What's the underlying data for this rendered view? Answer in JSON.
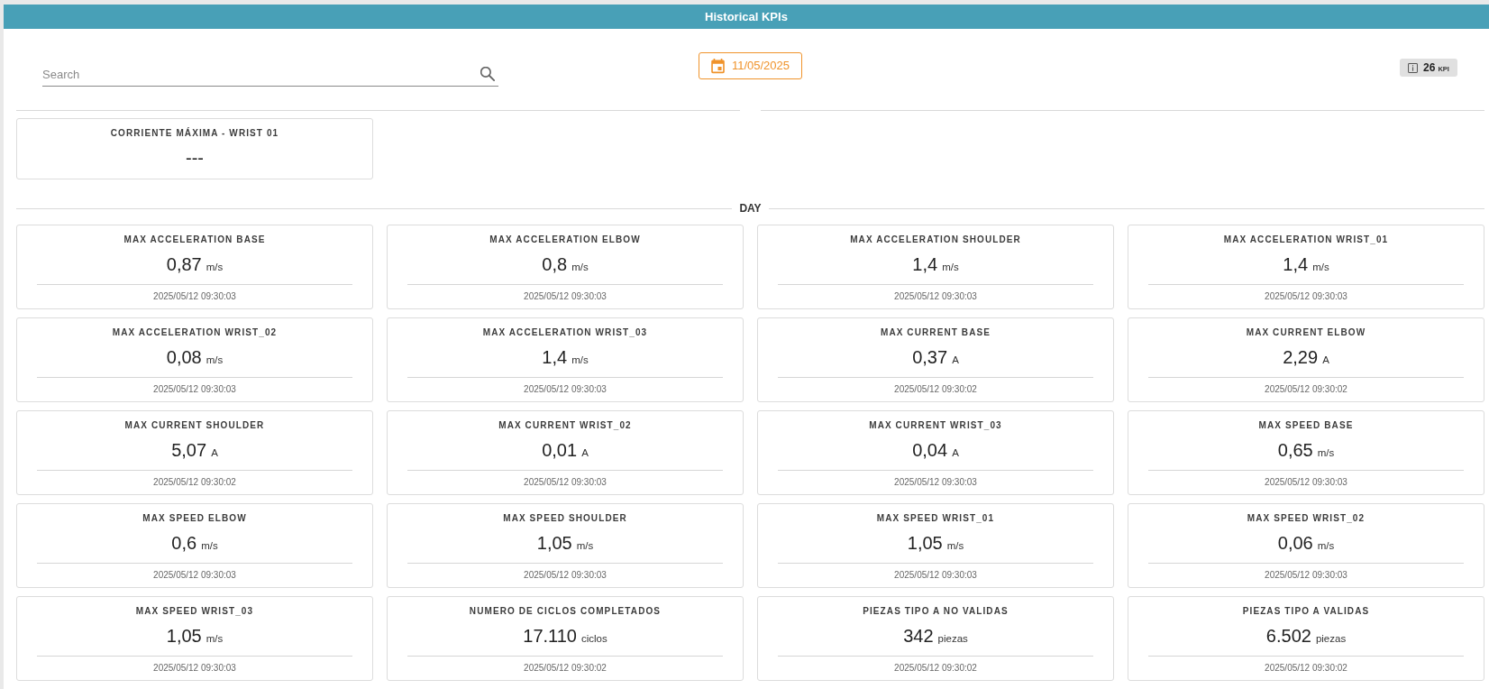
{
  "header": {
    "title": "Historical KPIs"
  },
  "toolbar": {
    "search": {
      "placeholder": "Search"
    },
    "date_button": {
      "label": "11/05/2025"
    },
    "kpi_badge": {
      "count": "26",
      "unit": "KPI"
    }
  },
  "pinned_cards": [
    {
      "title": "CORRIENTE MÁXIMA - WRIST 01",
      "value": "---"
    }
  ],
  "sections": [
    {
      "title": "DAY",
      "cards": [
        {
          "title": "MAX ACCELERATION BASE",
          "value": "0,87",
          "unit": "m/s",
          "timestamp": "2025/05/12 09:30:03"
        },
        {
          "title": "MAX ACCELERATION ELBOW",
          "value": "0,8",
          "unit": "m/s",
          "timestamp": "2025/05/12 09:30:03"
        },
        {
          "title": "MAX ACCELERATION SHOULDER",
          "value": "1,4",
          "unit": "m/s",
          "timestamp": "2025/05/12 09:30:03"
        },
        {
          "title": "MAX ACCELERATION WRIST_01",
          "value": "1,4",
          "unit": "m/s",
          "timestamp": "2025/05/12 09:30:03"
        },
        {
          "title": "MAX ACCELERATION WRIST_02",
          "value": "0,08",
          "unit": "m/s",
          "timestamp": "2025/05/12 09:30:03"
        },
        {
          "title": "MAX ACCELERATION WRIST_03",
          "value": "1,4",
          "unit": "m/s",
          "timestamp": "2025/05/12 09:30:03"
        },
        {
          "title": "MAX CURRENT BASE",
          "value": "0,37",
          "unit": "A",
          "timestamp": "2025/05/12 09:30:02"
        },
        {
          "title": "MAX CURRENT ELBOW",
          "value": "2,29",
          "unit": "A",
          "timestamp": "2025/05/12 09:30:02"
        },
        {
          "title": "MAX CURRENT SHOULDER",
          "value": "5,07",
          "unit": "A",
          "timestamp": "2025/05/12 09:30:02"
        },
        {
          "title": "MAX CURRENT WRIST_02",
          "value": "0,01",
          "unit": "A",
          "timestamp": "2025/05/12 09:30:03"
        },
        {
          "title": "MAX CURRENT WRIST_03",
          "value": "0,04",
          "unit": "A",
          "timestamp": "2025/05/12 09:30:03"
        },
        {
          "title": "MAX SPEED BASE",
          "value": "0,65",
          "unit": "m/s",
          "timestamp": "2025/05/12 09:30:03"
        },
        {
          "title": "MAX SPEED ELBOW",
          "value": "0,6",
          "unit": "m/s",
          "timestamp": "2025/05/12 09:30:03"
        },
        {
          "title": "MAX SPEED SHOULDER",
          "value": "1,05",
          "unit": "m/s",
          "timestamp": "2025/05/12 09:30:03"
        },
        {
          "title": "MAX SPEED WRIST_01",
          "value": "1,05",
          "unit": "m/s",
          "timestamp": "2025/05/12 09:30:03"
        },
        {
          "title": "MAX SPEED WRIST_02",
          "value": "0,06",
          "unit": "m/s",
          "timestamp": "2025/05/12 09:30:03"
        },
        {
          "title": "MAX SPEED WRIST_03",
          "value": "1,05",
          "unit": "m/s",
          "timestamp": "2025/05/12 09:30:03"
        },
        {
          "title": "NUMERO DE CICLOS COMPLETADOS",
          "value": "17.110",
          "unit": "ciclos",
          "timestamp": "2025/05/12 09:30:02"
        },
        {
          "title": "PIEZAS TIPO A NO VALIDAS",
          "value": "342",
          "unit": "piezas",
          "timestamp": "2025/05/12 09:30:02"
        },
        {
          "title": "PIEZAS TIPO A VALIDAS",
          "value": "6.502",
          "unit": "piezas",
          "timestamp": "2025/05/12 09:30:02"
        }
      ]
    }
  ]
}
